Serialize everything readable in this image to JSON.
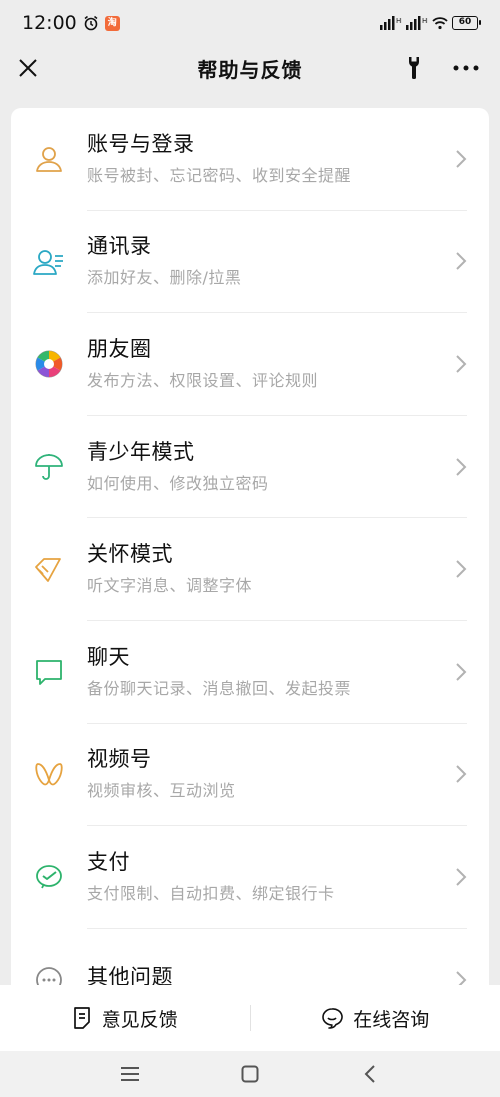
{
  "status_bar": {
    "time": "12:00",
    "app_badge": "淘",
    "battery": "60"
  },
  "header": {
    "title": "帮助与反馈"
  },
  "items": [
    {
      "title": "账号与登录",
      "subtitle": "账号被封、忘记密码、收到安全提醒",
      "icon": "person-icon",
      "color": "#e0a24a"
    },
    {
      "title": "通讯录",
      "subtitle": "添加好友、删除/拉黑",
      "icon": "contacts-icon",
      "color": "#2aa8c4"
    },
    {
      "title": "朋友圈",
      "subtitle": "发布方法、权限设置、评论规则",
      "icon": "moments-icon",
      "color": "#f0a020"
    },
    {
      "title": "青少年模式",
      "subtitle": "如何使用、修改独立密码",
      "icon": "umbrella-icon",
      "color": "#2fb37a"
    },
    {
      "title": "关怀模式",
      "subtitle": "听文字消息、调整字体",
      "icon": "care-icon",
      "color": "#e6a340"
    },
    {
      "title": "聊天",
      "subtitle": "备份聊天记录、消息撤回、发起投票",
      "icon": "chat-icon",
      "color": "#2db36c"
    },
    {
      "title": "视频号",
      "subtitle": "视频审核、互动浏览",
      "icon": "channels-icon",
      "color": "#e6a340"
    },
    {
      "title": "支付",
      "subtitle": "支付限制、自动扣费、绑定银行卡",
      "icon": "pay-icon",
      "color": "#2db36c"
    },
    {
      "title": "其他问题",
      "subtitle": "",
      "icon": "more-circle-icon",
      "color": "#888888"
    }
  ],
  "bottom_bar": {
    "feedback_label": "意见反馈",
    "consult_label": "在线咨询"
  }
}
